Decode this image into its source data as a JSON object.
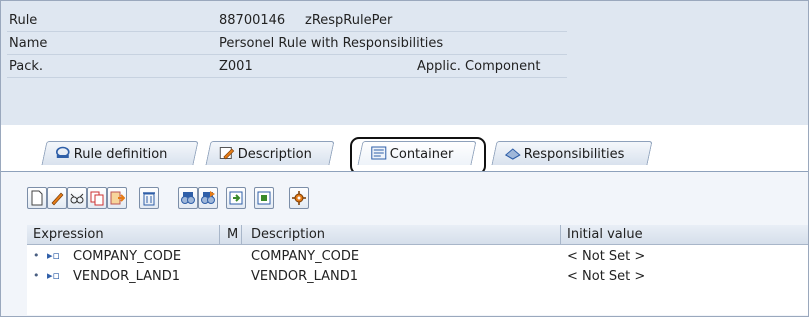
{
  "header": {
    "rule_label": "Rule",
    "rule_id": "88700146",
    "rule_code": "zRespRulePer",
    "name_label": "Name",
    "name_value": "Personel Rule with Responsibilities",
    "pack_label": "Pack.",
    "pack_value": "Z001",
    "applic_label": "Applic. Component"
  },
  "tabs": [
    {
      "label": "Rule definition",
      "icon": "rule-definition-icon"
    },
    {
      "label": "Description",
      "icon": "description-icon"
    },
    {
      "label": "Container",
      "icon": "container-icon",
      "active": true
    },
    {
      "label": "Responsibilities",
      "icon": "responsibilities-icon"
    }
  ],
  "toolbar": {
    "buttons": [
      "create-icon",
      "edit-icon",
      "glasses-icon",
      "copy-icon",
      "insert-icon",
      "delete-icon",
      "find-icon",
      "find-next-icon",
      "import-icon",
      "export-icon",
      "settings-icon"
    ]
  },
  "table": {
    "columns": [
      "Expression",
      "M",
      "Description",
      "Initial value"
    ],
    "rows": [
      {
        "expression": "COMPANY_CODE",
        "description": "COMPANY_CODE",
        "initial": "< Not Set >"
      },
      {
        "expression": "VENDOR_LAND1",
        "description": "VENDOR_LAND1",
        "initial": "< Not Set >"
      }
    ]
  },
  "colors": {
    "header_bg": "#dfe7f1",
    "content_bg": "#f2f5fa",
    "icon_orange": "#e57b16",
    "icon_blue": "#2f5fa8"
  }
}
